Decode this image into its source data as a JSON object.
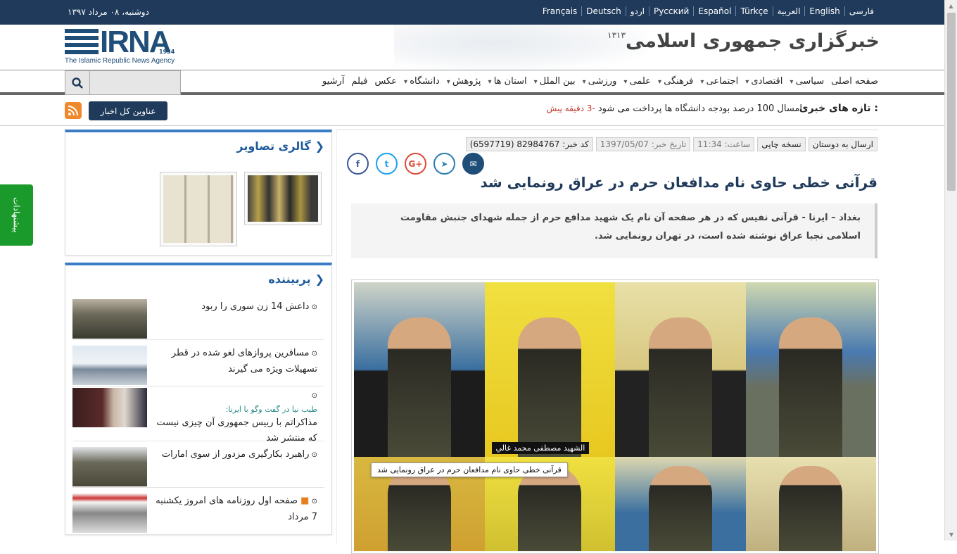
{
  "topbar": {
    "date": "دوشنبه، ۰۸ مرداد ۱۳۹۷",
    "languages": [
      "فارسی",
      "English",
      "العربية",
      "Türkçe",
      "Español",
      "Русский",
      "اردو",
      "Deutsch",
      "Français"
    ]
  },
  "header": {
    "logo_text": "IRNA",
    "logo_year": "1934",
    "logo_subtitle": "The Islamic Republic News Agency",
    "brand_title": "خبرگزاری جمهوری اسلامی",
    "brand_year": "۱۳۱۳"
  },
  "nav": {
    "items": [
      {
        "label": "صفحه اصلی",
        "dropdown": false
      },
      {
        "label": "سیاسی",
        "dropdown": true
      },
      {
        "label": "اقتصادی",
        "dropdown": true
      },
      {
        "label": "اجتماعی",
        "dropdown": true
      },
      {
        "label": "فرهنگی",
        "dropdown": true
      },
      {
        "label": "علمی",
        "dropdown": true
      },
      {
        "label": "ورزشی",
        "dropdown": true
      },
      {
        "label": "بین الملل",
        "dropdown": true
      },
      {
        "label": "استان ها",
        "dropdown": true
      },
      {
        "label": "پژوهش",
        "dropdown": true
      },
      {
        "label": "دانشگاه",
        "dropdown": true
      },
      {
        "label": "عکس",
        "dropdown": false
      },
      {
        "label": "فیلم",
        "dropdown": false
      },
      {
        "label": "آرشیو",
        "dropdown": false
      }
    ],
    "search_icon": "search-icon"
  },
  "ticker": {
    "label": "تازه های خبری :",
    "headline": "امسال 100 درصد بودجه دانشگاه ها پرداخت می شود",
    "ago": "-3 دقیقه پیش",
    "all_news_button": "عناوین کل اخبار",
    "rss_icon": "rss-icon"
  },
  "sidebar": {
    "gallery_title": "گالری تصاویر",
    "popular_title": "پربیننده",
    "popular_items": [
      {
        "prefix": "",
        "title": "داعش 14 زن سوری را ربود",
        "icon": "clock-icon"
      },
      {
        "prefix": "",
        "title": "مسافرین پروازهای لغو شده در قطر تسهیلات ویژه می گیرند",
        "icon": "clock-icon"
      },
      {
        "prefix": "طیب نیا در گفت وگو با ایرنا:",
        "title": "مذاکراتم با رییس جمهوری آن چیزی نیست که منتشر شد",
        "icon": "clock-icon"
      },
      {
        "prefix": "",
        "title": "راهبرد بکارگیری مزدور از سوی امارات",
        "icon": "clock-icon"
      },
      {
        "prefix": "",
        "title": "صفحه اول روزنامه های امروز یکشنبه 7 مرداد",
        "icon": "video-icon"
      }
    ]
  },
  "article": {
    "meta": {
      "code": "کد خبر: 82984767 (6597719)",
      "date": "تاریخ خبر: 1397/05/07",
      "time": "ساعت: 11:34",
      "print": "نسخه چاپی",
      "send": "ارسال به دوستان"
    },
    "social_icons": [
      "facebook-icon",
      "twitter-icon",
      "google-plus-icon",
      "telegram-icon",
      "email-icon"
    ],
    "headline": "قرآنی خطی حاوی نام مدافعان حرم در عراق رونمایی شد",
    "lead": "بغداد – ایرنا - قرآنی نفیس که در هر صفحه آن نام یک شهید مدافع حرم از جمله شهدای جنبش مقاومت اسلامی نجبا عراق نوشته شده است، در تهران رونمایی شد.",
    "photo_caption": "قرآنی خطی حاوی نام مدافعان حرم در عراق رونمایی شد",
    "photo_nametag": "الشهید مصطفی محمد غالي"
  },
  "floating": {
    "suggest_label": "پیشنهادات"
  },
  "colors": {
    "topbar": "#1f3a5a",
    "accent": "#3b7dc4",
    "suggest": "#1a9a2a",
    "rss": "#f0892c"
  }
}
